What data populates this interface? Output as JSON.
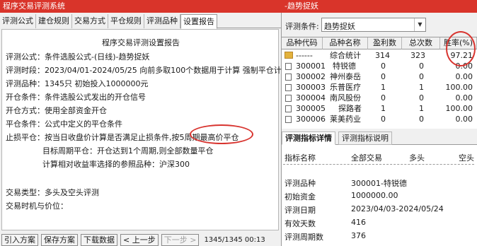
{
  "left_window": {
    "title": "程序交易评测系统",
    "tabs": [
      "评测公式",
      "建仓规则",
      "交易方式",
      "平仓规则",
      "评测品种",
      "设置报告"
    ],
    "active_tab": "设置报告",
    "report": {
      "title": "程序交易评测设置报告",
      "lines": [
        "评测公式：条件选股公式-(日线)-趋势捉妖",
        "评测时段：2023/04/01-2024/05/25 向前多取100个数据用于计算 强制平仓计入收益",
        "评测品种：1345只 初始投入1000000元",
        "开仓条件：条件选股公式发出的开仓信号",
        "开仓方式：使用全部资金开仓",
        "平仓条件：公式中定义的平仓条件",
        "止损平仓：按当日收盘价计算是否满足止损条件,按5周期最高价平仓"
      ],
      "indent_lines": [
        "目标周期平仓：开仓达到1个周期,则全部数量平仓",
        "计算相对收益率选择的参照品种：沪深300"
      ],
      "trade_type": "交易类型：多头及空头评测",
      "trade_timing": "交易时机与价位："
    },
    "bottom": {
      "buttons": [
        "引入方案",
        "保存方案",
        "下载数据",
        "< 上一步",
        "下一步 >"
      ],
      "status": "1345/1345  00:13"
    }
  },
  "right_window": {
    "title": "-趋势捉妖",
    "condition_label": "评测条件:",
    "condition_value": "趋势捉妖",
    "grid": {
      "headers": [
        "品种代码",
        "品种名称",
        "盈利数",
        "总次数",
        "胜率(%)"
      ],
      "summary": {
        "code": "------",
        "name": "综合统计",
        "profit": "314",
        "total": "323",
        "rate": "97.21"
      },
      "rows": [
        {
          "code": "300001",
          "name": "特锐德",
          "profit": "0",
          "total": "0",
          "rate": "0.00"
        },
        {
          "code": "300002",
          "name": "神州泰岳",
          "profit": "0",
          "total": "0",
          "rate": "0.00"
        },
        {
          "code": "300003",
          "name": "乐普医疗",
          "profit": "1",
          "total": "1",
          "rate": "100.00"
        },
        {
          "code": "300004",
          "name": "南风股份",
          "profit": "0",
          "total": "0",
          "rate": "0.00"
        },
        {
          "code": "300005",
          "name": "探路者",
          "profit": "1",
          "total": "1",
          "rate": "100.00"
        },
        {
          "code": "300006",
          "name": "莱美药业",
          "profit": "0",
          "total": "0",
          "rate": "0.00"
        }
      ]
    },
    "detail_tabs": [
      "评测指标详情",
      "评测指标说明"
    ],
    "detail": {
      "headers": [
        "指标名称",
        "全部交易",
        "多头",
        "空头"
      ],
      "rows": [
        {
          "label": "评测品种",
          "value": "300001-特锐德"
        },
        {
          "label": "初始资金",
          "value": "1000000.00"
        },
        {
          "label": "评测日期",
          "value": "2023/04/03-2024/05/24"
        },
        {
          "label": "有效天数",
          "value": "416"
        },
        {
          "label": "评测周期数",
          "value": "376"
        }
      ]
    }
  }
}
